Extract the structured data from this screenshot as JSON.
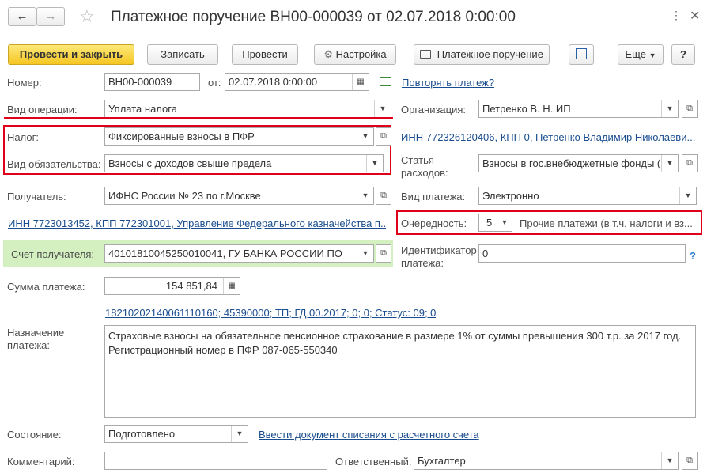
{
  "header": {
    "title": "Платежное поручение ВН00-000039 от 02.07.2018 0:00:00",
    "back_icon": "arrow-left-icon",
    "forward_icon": "arrow-right-icon",
    "star_icon": "star-icon",
    "more_icon": "more-vertical-icon",
    "close_icon": "close-icon"
  },
  "toolbar": {
    "post_close": "Провести и закрыть",
    "save": "Записать",
    "post": "Провести",
    "settings": "Настройка",
    "payment_order": "Платежное поручение",
    "more": "Еще",
    "help": "?"
  },
  "form": {
    "number_label": "Номер:",
    "number_value": "ВН00-000039",
    "date_from_label": "от:",
    "date_value": "02.07.2018  0:00:00",
    "repeat_link": "Повторять платеж?",
    "op_type_label": "Вид операции:",
    "op_type_value": "Уплата налога",
    "org_label": "Организация:",
    "org_value": "Петренко В. Н. ИП",
    "tax_label": "Налог:",
    "tax_value": "Фиксированные взносы в ПФР",
    "org_inn_link": "ИНН 772326120406, КПП 0, Петренко Владимир Николаеви...",
    "obligation_label": "Вид обязательства:",
    "obligation_value": "Взносы с доходов свыше предела",
    "expense_label_1": "Статья",
    "expense_label_2": "расходов:",
    "expense_value": "Взносы в гос.внебюджетные фонды (",
    "recipient_label": "Получатель:",
    "recipient_value": "ИФНС России № 23 по г.Москве",
    "payment_type_label": "Вид платежа:",
    "payment_type_value": "Электронно",
    "recipient_inn_link": "ИНН 7723013452, КПП 772301001, Управление Федерального казначейства п...",
    "priority_label": "Очередность:",
    "priority_value": "5",
    "priority_desc": "Прочие платежи (в т.ч. налоги и вз...",
    "account_label": "Счет получателя:",
    "account_value": "40101810045250010041, ГУ БАНКА РОССИИ ПО",
    "identifier_label_1": "Идентификатор",
    "identifier_label_2": "платежа:",
    "identifier_value": "0",
    "help_q": "?",
    "amount_label": "Сумма платежа:",
    "amount_value": "154 851,84",
    "kbk_link": "18210202140061110160; 45390000; ТП; ГД.00.2017; 0; 0; Статус: 09; 0",
    "purpose_label_1": "Назначение",
    "purpose_label_2": "платежа:",
    "purpose_line_1": "Страховые взносы на обязательное пенсионное страхование в размере 1% от суммы превышения 300 т.р. за 2017 год.",
    "purpose_line_2": "Регистрационный номер в ПФР 087-065-550340",
    "state_label": "Состояние:",
    "state_value": "Подготовлено",
    "writeoff_link": "Ввести документ списания с расчетного счета",
    "comment_label": "Комментарий:",
    "comment_value": "",
    "responsible_label": "Ответственный:",
    "responsible_value": "Бухгалтер"
  },
  "colors": {
    "highlight_red": "#e0001b",
    "account_bg": "#d4f0c0",
    "link": "#1a4d8f",
    "accent_yellow": "#f5c622"
  }
}
